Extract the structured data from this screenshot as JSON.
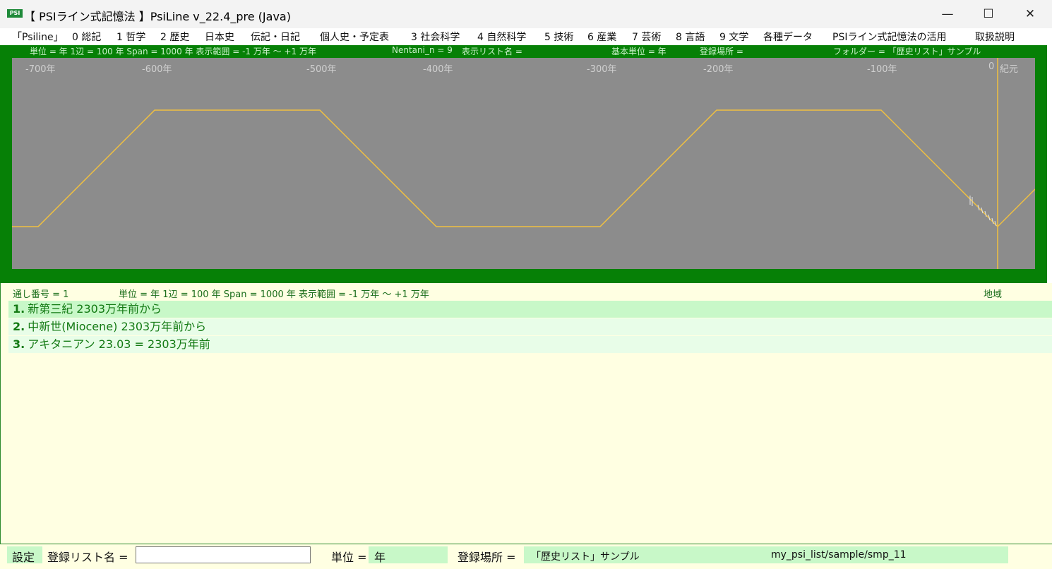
{
  "window": {
    "icon_text": "PSI",
    "title": "【 PSIライン式記憶法 】PsiLine v_22.4_pre (Java)",
    "minimize": "—",
    "maximize": "☐",
    "close": "✕"
  },
  "menu": [
    "「Psiline」",
    "0 総記",
    "1 哲学",
    "2 歴史",
    "日本史",
    "伝記・日記",
    "個人史・予定表",
    "3 社会科学",
    "4 自然科学",
    "5 技術",
    "6 産業",
    "7 芸術",
    "8 言語",
    "9 文学",
    "各種データ",
    "PSIライン式記憶法の活用",
    "取扱説明"
  ],
  "top_info": {
    "unit": "単位 = 年  1辺 = 100 年  Span = 1000 年  表示範囲 = -1 万年 ～ +1 万年",
    "nentani": "Nentani_n = 9",
    "list_name": "表示リスト名 =",
    "base_unit": "基本単位 = 年",
    "reg_place": "登録場所 =",
    "folder": "フォルダー = 「歴史リスト」サンプル"
  },
  "axis_ticks": [
    "-700年",
    "-600年",
    "-500年",
    "-400年",
    "-300年",
    "-200年",
    "-100年",
    "0",
    "紀元"
  ],
  "colors": {
    "panel_green": "#068006",
    "plot_gray": "#8c8c8c",
    "line": "#f0c040",
    "lower_bg": "#ffffe2",
    "row_highlight": "#c8f8c8"
  },
  "lower_info": {
    "serial": "通し番号 = 1",
    "unit": "単位 = 年  1辺 = 100 年  Span = 1000 年  表示範囲 = -1 万年 ～ +1 万年",
    "region": "地域"
  },
  "list": [
    {
      "num": "1.",
      "text": "新第三紀 2303万年前から"
    },
    {
      "num": "2.",
      "text": "中新世(Miocene) 2303万年前から"
    },
    {
      "num": "3.",
      "text": "アキタニアン 23.03 = 2303万年前"
    }
  ],
  "bottom": {
    "settings": "設定",
    "reg_list_label": "登録リスト名 =",
    "reg_list_value": "",
    "unit_label": "単位 =",
    "unit_value": "年",
    "place_label": "登録場所 =",
    "place_value": "「歴史リスト」サンプル",
    "path": "my_psi_list/sample/smp_11"
  }
}
